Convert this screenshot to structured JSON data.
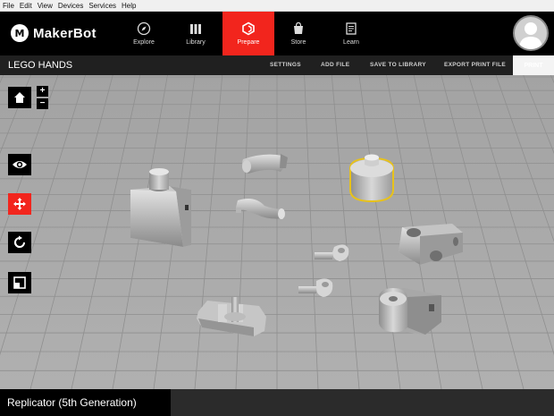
{
  "menu": [
    "File",
    "Edit",
    "View",
    "Devices",
    "Services",
    "Help"
  ],
  "brand": {
    "logo_letter": "M",
    "name": "MakerBot"
  },
  "nav": [
    {
      "label": "Explore",
      "icon": "compass-icon",
      "active": false
    },
    {
      "label": "Library",
      "icon": "library-icon",
      "active": false
    },
    {
      "label": "Prepare",
      "icon": "prepare-icon",
      "active": true
    },
    {
      "label": "Store",
      "icon": "store-icon",
      "active": false
    },
    {
      "label": "Learn",
      "icon": "learn-icon",
      "active": false
    }
  ],
  "project": {
    "title": "LEGO HANDS"
  },
  "actions": {
    "settings": "SETTINGS",
    "add_file": "ADD FILE",
    "save": "SAVE TO LIBRARY",
    "export": "EXPORT PRINT FILE",
    "print": "PRINT"
  },
  "view_controls": {
    "home_icon": "home-icon",
    "zoom_in": "+",
    "zoom_out": "−"
  },
  "tools": [
    {
      "name": "look",
      "icon": "eye-icon",
      "active": false
    },
    {
      "name": "move",
      "icon": "move-icon",
      "active": true
    },
    {
      "name": "rotate",
      "icon": "rotate-icon",
      "active": false
    },
    {
      "name": "scale",
      "icon": "scale-icon",
      "active": false
    }
  ],
  "status": {
    "printer": "Replicator (5th Generation)"
  },
  "colors": {
    "accent": "#f2251d",
    "header": "#000000",
    "plate": "#a9a9a9",
    "selection": "#e8c21a"
  }
}
